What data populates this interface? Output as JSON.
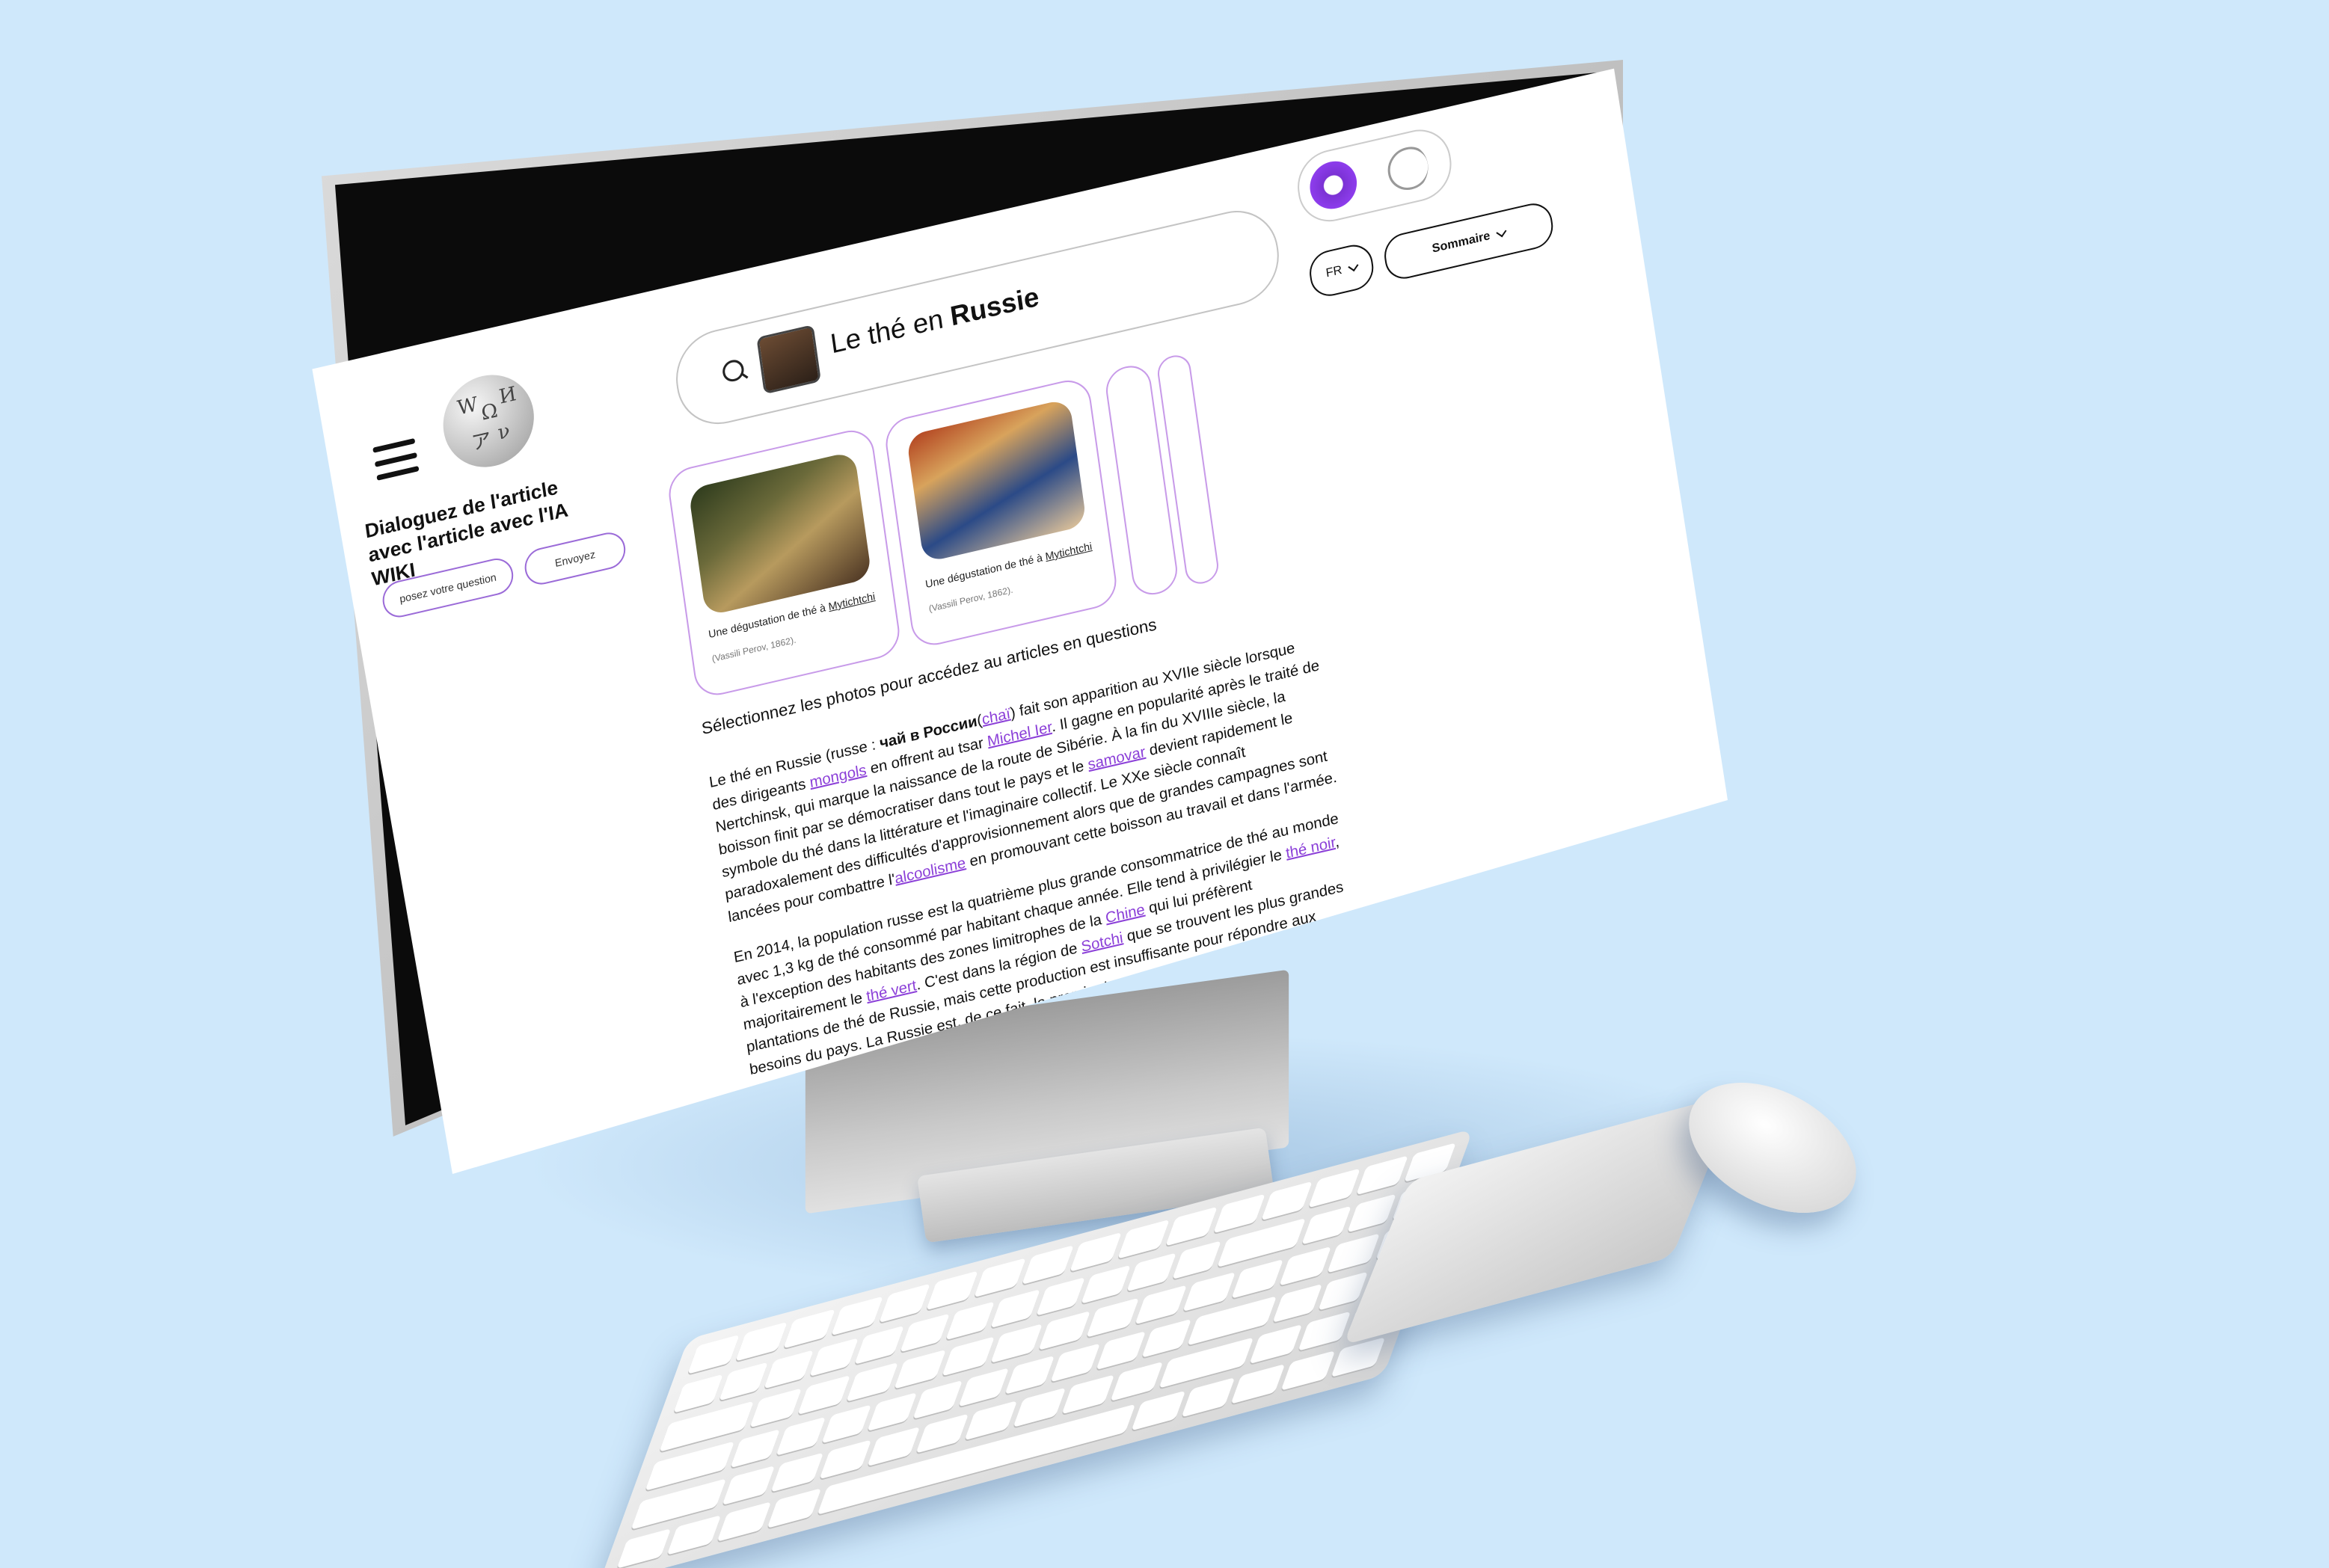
{
  "sidebar": {
    "chat_title": "Dialoguez de l'article avec l'article avec l'IA WIKI",
    "ask_placeholder": "posez votre question",
    "send_label": "Envoyez"
  },
  "search": {
    "query_prefix": "Le thé en",
    "query_bold": "Russie"
  },
  "controls": {
    "lang_label": "FR",
    "summary_label": "Sommaire",
    "accent_color": "#9b45ff"
  },
  "gallery": {
    "cards": [
      {
        "caption": "Une dégustation de thé à",
        "link": "Mytichtchi",
        "credit": "(Vassili Perov, 1862)."
      },
      {
        "caption": "Une dégustation de thé à",
        "link": "Mytichtchi",
        "credit": "(Vassili Perov, 1862)."
      }
    ],
    "hint": "Sélectionnez les photos pour accédez au articles en questions"
  },
  "article": {
    "p1": [
      "Le thé en Russie (russe : ",
      "чай в России",
      "chaï",
      ") fait son apparition au XVIIe siècle lorsque des dirigeants ",
      "mongols",
      " en offrent au tsar ",
      "Michel Ier",
      ". Il gagne en popularité après le traité de Nertchinsk, qui marque la naissance de la route de Sibérie. À la fin du XVIIIe siècle, la boisson finit par se démocratiser dans tout le pays et le ",
      "samovar",
      " devient rapidement le symbole du thé dans la littérature et l'imaginaire collectif. Le XXe siècle connaît paradoxalement des difficultés d'approvisionnement alors que de grandes campagnes sont lancées pour combattre l'",
      "alcoolisme",
      " en promouvant cette boisson au travail et dans l'armée."
    ],
    "p2": [
      "En 2014, la population russe est la quatrième plus grande consommatrice de thé au monde avec 1,3 kg de thé consommé par habitant chaque année. Elle tend à privilégier le ",
      "thé noir",
      ", à l'exception des habitants des zones limitrophes de la ",
      "Chine",
      " qui lui préfèrent majoritairement le ",
      "thé vert",
      ". C'est dans la région de ",
      "Sotchi",
      " que se trouvent les plus grandes plantations de thé de Russie, mais cette production est insuffisante pour répondre aux besoins du pays. La Russie est, de ce fait, le premier importateur de thé au"
    ]
  }
}
